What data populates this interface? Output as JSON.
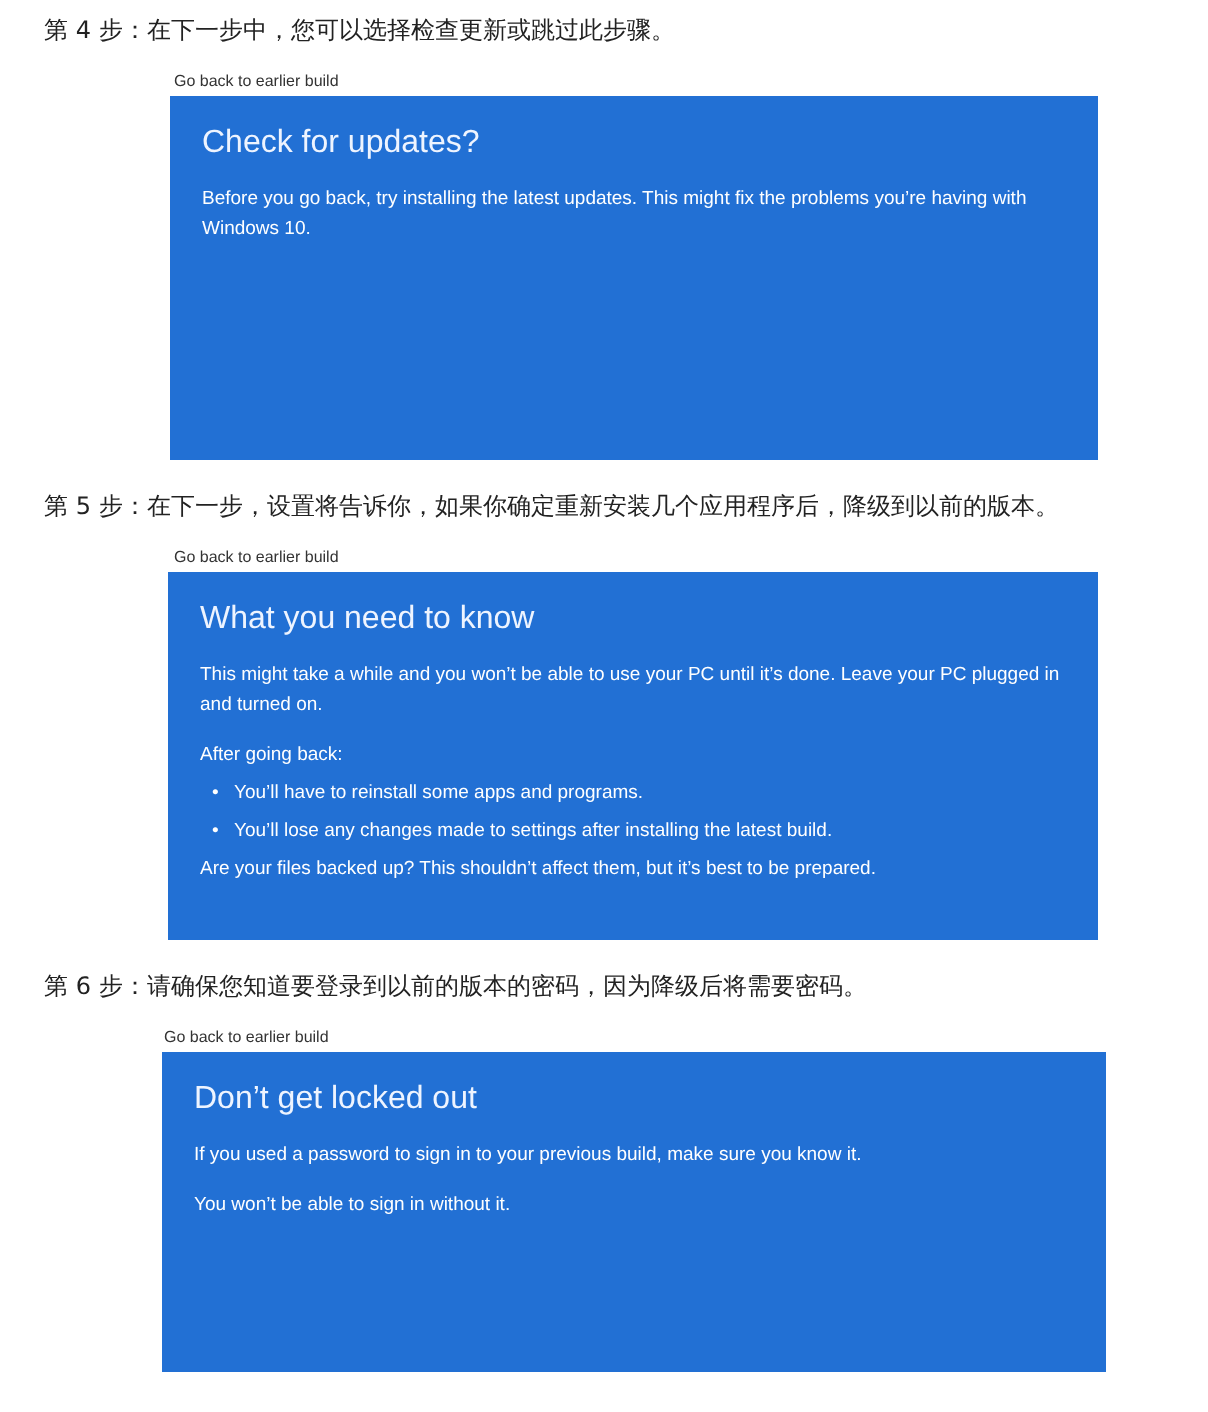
{
  "steps": [
    {
      "caption": "第 4 步：在下一步中，您可以选择检查更新或跳过此步骤。",
      "screenshot": {
        "title": "Go back to earlier build",
        "heading": "Check for updates?",
        "blocks": [
          {
            "kind": "paragraph",
            "text": "Before you go back, try installing the latest updates. This might fix the problems you’re having with Windows 10."
          }
        ]
      }
    },
    {
      "caption": "第 5 步：在下一步，设置将告诉你，如果你确定重新安装几个应用程序后，降级到以前的版本。",
      "screenshot": {
        "title": "Go back to earlier build",
        "heading": "What you need to know",
        "blocks": [
          {
            "kind": "paragraph",
            "text": "This might take a while and you won’t be able to use your PC until it’s done. Leave your PC plugged in and turned on."
          },
          {
            "kind": "line",
            "text": "After going back:"
          },
          {
            "kind": "bullet",
            "marker": "•",
            "text": "You’ll have to reinstall some apps and programs."
          },
          {
            "kind": "bullet",
            "marker": "•",
            "text": "You’ll lose any changes made to settings after installing the latest build."
          },
          {
            "kind": "line",
            "text": "Are your files backed up? This shouldn’t affect them, but it’s best to be prepared."
          }
        ]
      }
    },
    {
      "caption": "第 6 步：请确保您知道要登录到以前的版本的密码，因为降级后将需要密码。",
      "screenshot": {
        "title": "Go back to earlier build",
        "heading": "Don’t get locked out",
        "blocks": [
          {
            "kind": "paragraph",
            "text": "If you used a password to sign in to your previous build, make sure you know it."
          },
          {
            "kind": "paragraph",
            "text": "You won’t be able to sign in without it."
          }
        ]
      }
    }
  ]
}
